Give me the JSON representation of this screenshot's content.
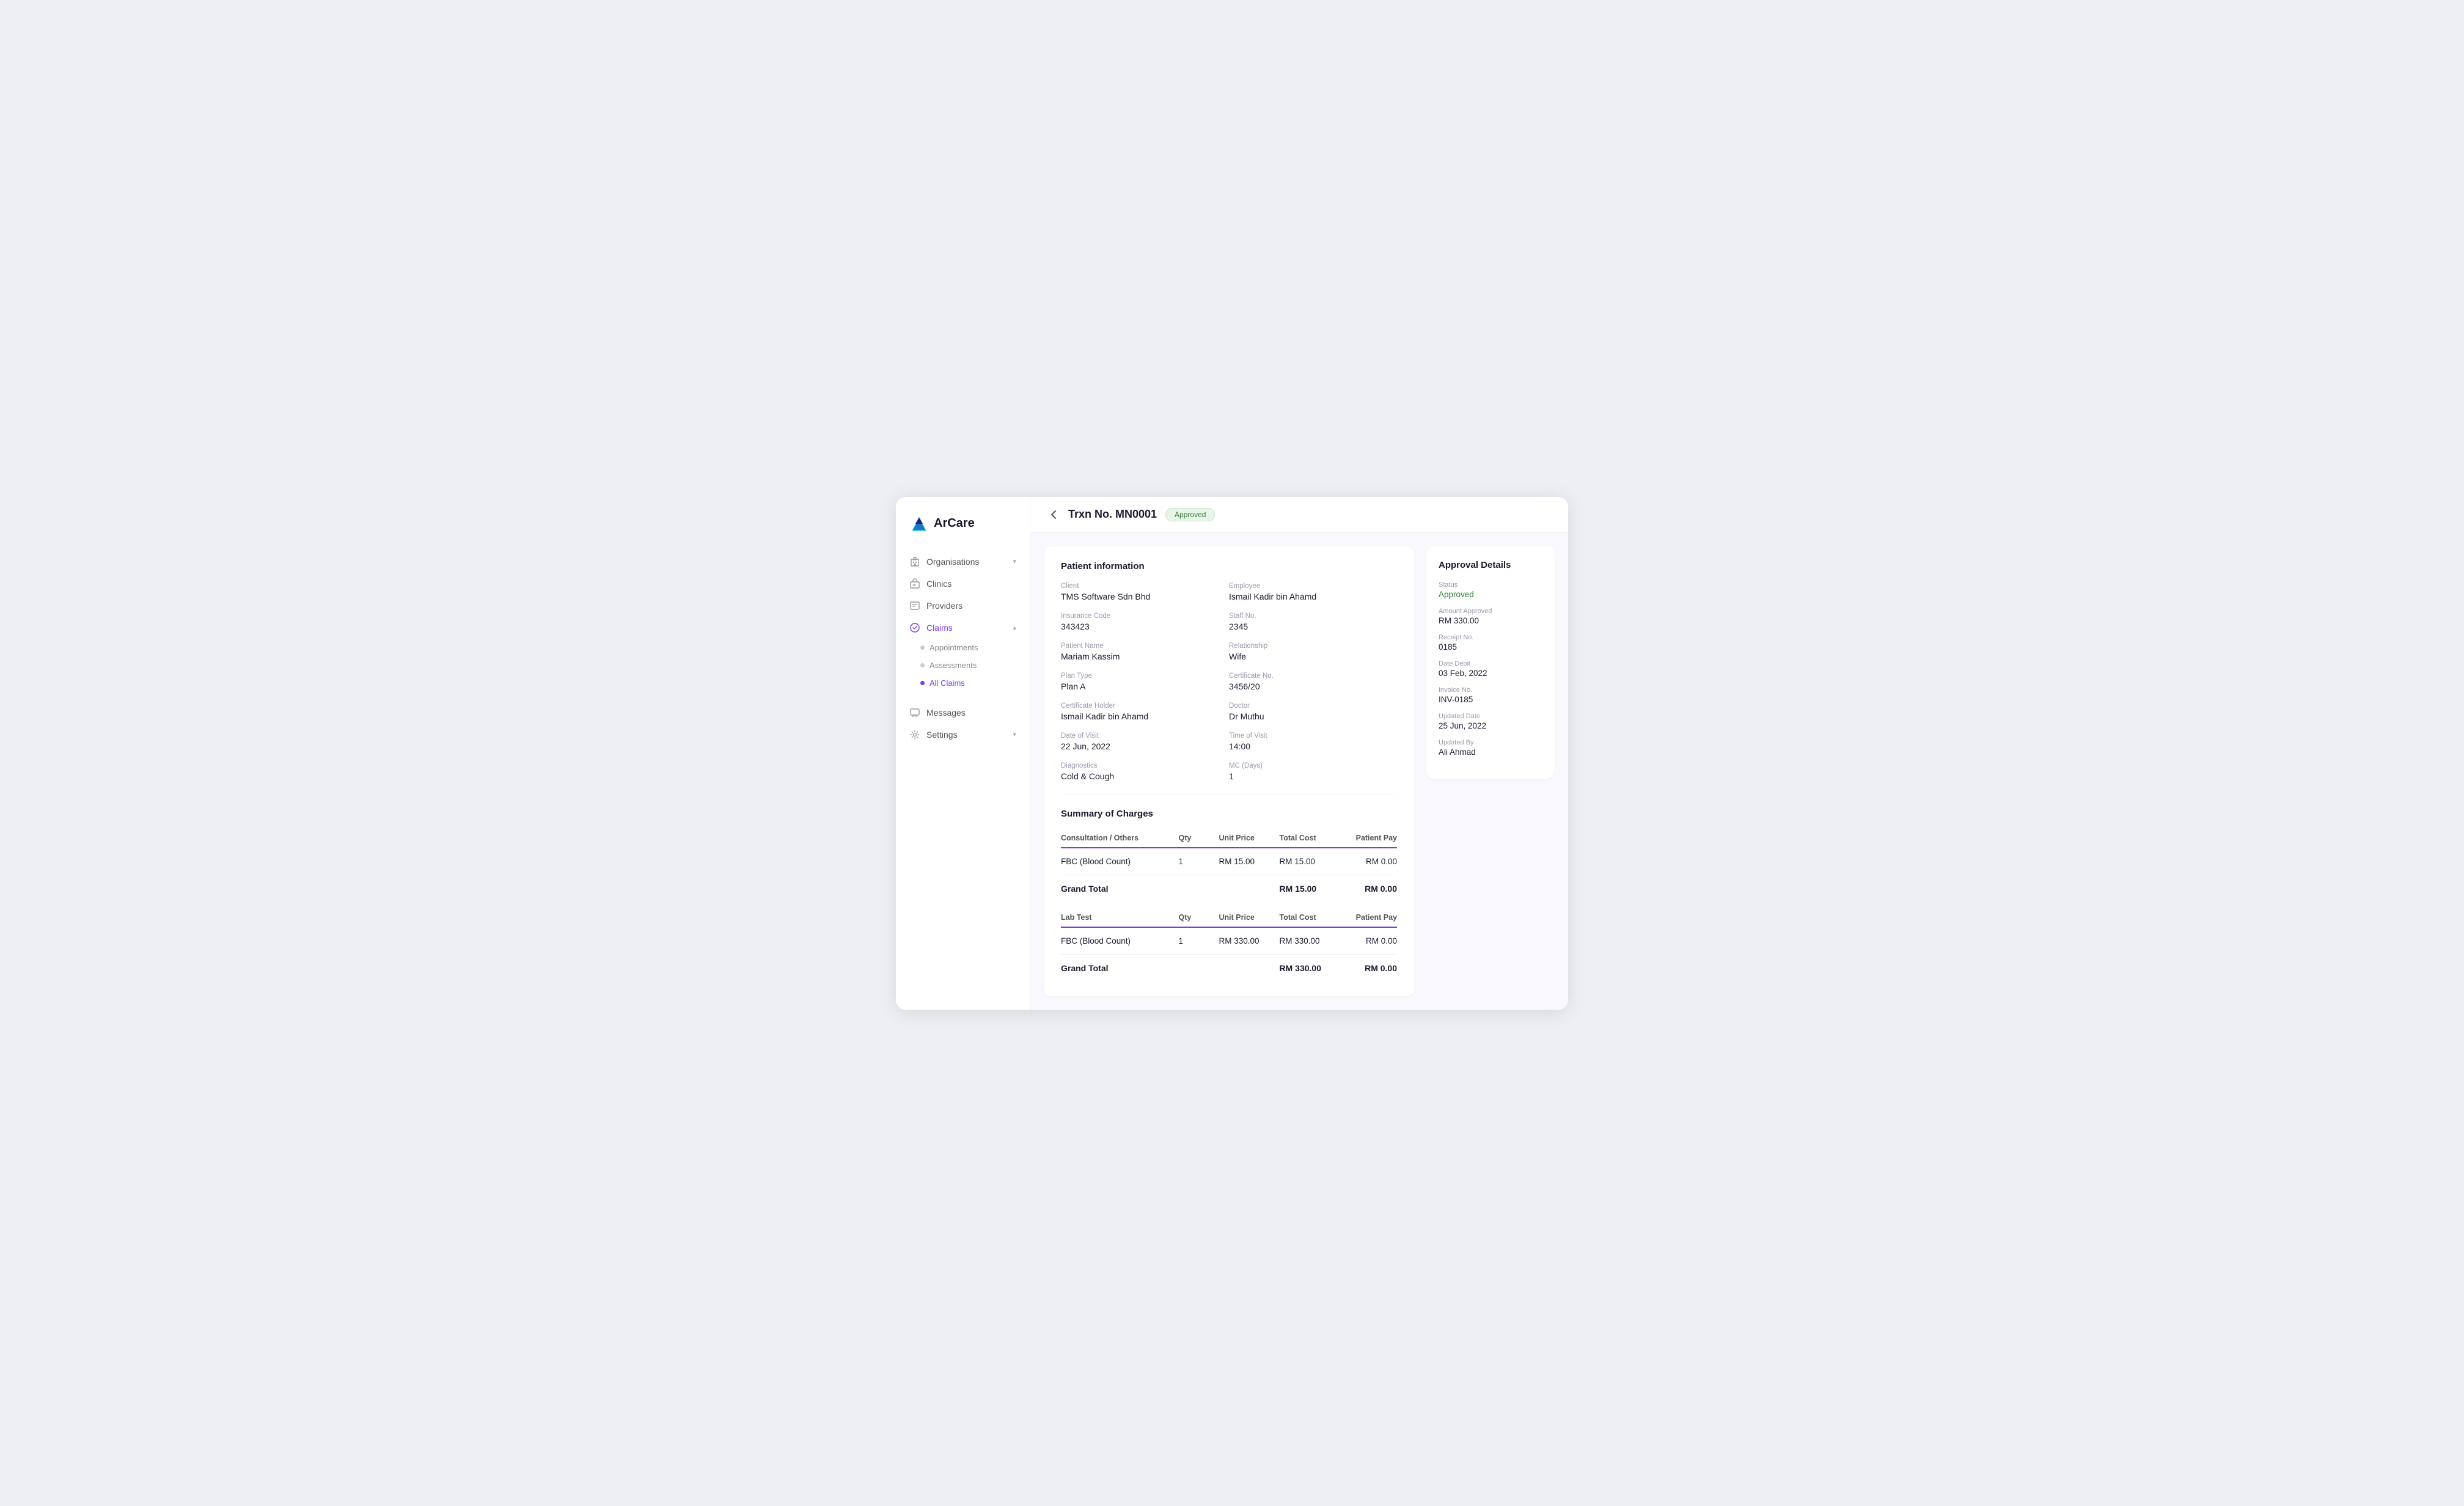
{
  "logo": {
    "text": "ArCare"
  },
  "sidebar": {
    "items": [
      {
        "id": "organisations",
        "label": "Organisations",
        "icon": "building-icon",
        "hasChevron": true,
        "active": false
      },
      {
        "id": "clinics",
        "label": "Clinics",
        "icon": "clinic-icon",
        "hasChevron": false,
        "active": false
      },
      {
        "id": "providers",
        "label": "Providers",
        "icon": "providers-icon",
        "hasChevron": false,
        "active": false
      },
      {
        "id": "claims",
        "label": "Claims",
        "icon": "claims-icon",
        "hasChevron": true,
        "active": true
      }
    ],
    "subItems": [
      {
        "id": "appointments",
        "label": "Appointments",
        "active": false
      },
      {
        "id": "assessments",
        "label": "Assessments",
        "active": false
      },
      {
        "id": "all-claims",
        "label": "All Claims",
        "active": true
      }
    ],
    "bottomItems": [
      {
        "id": "messages",
        "label": "Messages",
        "icon": "messages-icon"
      },
      {
        "id": "settings",
        "label": "Settings",
        "icon": "settings-icon",
        "hasChevron": true
      }
    ]
  },
  "header": {
    "back_button": "←",
    "title": "Trxn No. MN0001",
    "status": "Approved"
  },
  "patient_info": {
    "section_title": "Patient information",
    "fields": [
      {
        "label": "Client",
        "value": "TMS Software Sdn Bhd"
      },
      {
        "label": "Employee",
        "value": "Ismail Kadir bin Ahamd"
      },
      {
        "label": "Insurance Code",
        "value": "343423"
      },
      {
        "label": "Staff No.",
        "value": "2345"
      },
      {
        "label": "Patient Name",
        "value": "Mariam Kassim"
      },
      {
        "label": "Relationship",
        "value": "Wife"
      },
      {
        "label": "Plan Type",
        "value": "Plan A"
      },
      {
        "label": "Certificate No.",
        "value": "3456/20"
      },
      {
        "label": "Certificate Holder",
        "value": "Ismail Kadir bin Ahamd"
      },
      {
        "label": "Doctor",
        "value": "Dr Muthu"
      },
      {
        "label": "Date of Visit",
        "value": "22 Jun, 2022"
      },
      {
        "label": "Time of Visit",
        "value": "14:00"
      },
      {
        "label": "Diagnostics",
        "value": "Cold & Cough"
      },
      {
        "label": "MC (Days)",
        "value": "1"
      }
    ]
  },
  "charges": {
    "section_title": "Summary of Charges",
    "table1": {
      "columns": [
        "Consultation / Others",
        "Qty",
        "Unit Price",
        "Total Cost",
        "Patient Pay"
      ],
      "rows": [
        {
          "name": "FBC (Blood Count)",
          "qty": "1",
          "unit_price": "RM 15.00",
          "total_cost": "RM 15.00",
          "patient_pay": "RM 0.00"
        }
      ],
      "grand_total": {
        "label": "Grand Total",
        "total_cost": "RM 15.00",
        "patient_pay": "RM 0.00"
      }
    },
    "table2": {
      "columns": [
        "Lab Test",
        "Qty",
        "Unit Price",
        "Total Cost",
        "Patient Pay"
      ],
      "rows": [
        {
          "name": "FBC (Blood Count)",
          "qty": "1",
          "unit_price": "RM 330.00",
          "total_cost": "RM 330.00",
          "patient_pay": "RM 0.00"
        }
      ],
      "grand_total": {
        "label": "Grand Total",
        "total_cost": "RM 330.00",
        "patient_pay": "RM 0.00"
      }
    }
  },
  "approval": {
    "title": "Approval Details",
    "fields": [
      {
        "label": "Status",
        "value": "Approved",
        "green": true
      },
      {
        "label": "Amount Approved",
        "value": "RM 330.00"
      },
      {
        "label": "Receipt No.",
        "value": "0185"
      },
      {
        "label": "Date Debit",
        "value": "03 Feb, 2022"
      },
      {
        "label": "Invoice No.",
        "value": "INV-0185"
      },
      {
        "label": "Updated Date",
        "value": "25 Jun, 2022"
      },
      {
        "label": "Updated By",
        "value": "Ali Ahmad"
      }
    ]
  }
}
